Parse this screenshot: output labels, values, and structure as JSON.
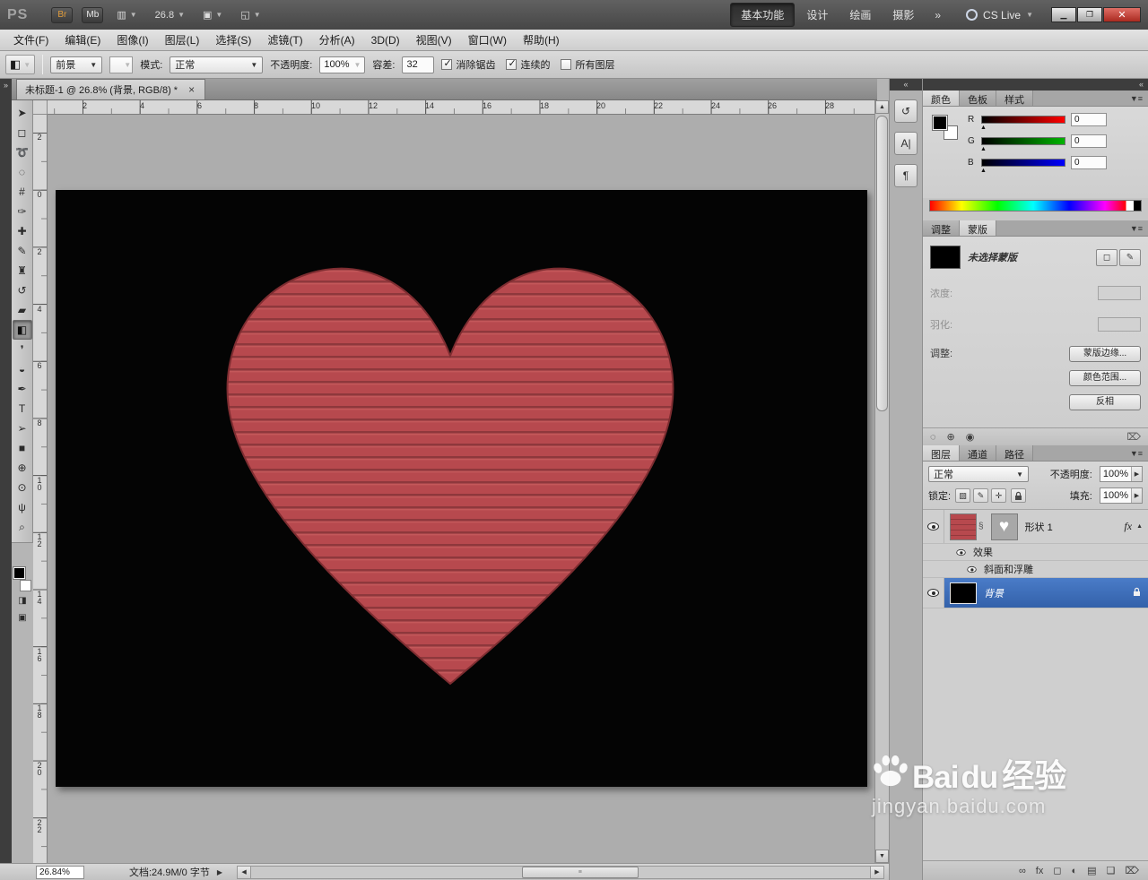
{
  "titlebar": {
    "logo": "PS",
    "bridge_button": "Br",
    "mini_bridge_button": "Mb",
    "zoom_value": "26.8",
    "workspaces": [
      {
        "name": "workspace-tab-essentials",
        "label": "基本功能",
        "active": true
      },
      {
        "name": "workspace-tab-design",
        "label": "设计"
      },
      {
        "name": "workspace-tab-painting",
        "label": "绘画"
      },
      {
        "name": "workspace-tab-photography",
        "label": "摄影"
      }
    ],
    "workspace_overflow": "»",
    "cs_live_label": "CS Live"
  },
  "menubar": {
    "items": [
      "文件(F)",
      "编辑(E)",
      "图像(I)",
      "图层(L)",
      "选择(S)",
      "滤镜(T)",
      "分析(A)",
      "3D(D)",
      "视图(V)",
      "窗口(W)",
      "帮助(H)"
    ]
  },
  "options": {
    "fill_source": "前景",
    "mode_label": "模式:",
    "mode_value": "正常",
    "opacity_label": "不透明度:",
    "opacity_value": "100%",
    "tolerance_label": "容差:",
    "tolerance_value": "32",
    "checkboxes": [
      {
        "name": "anti-alias-checkbox",
        "label": "消除锯齿",
        "checked": true
      },
      {
        "name": "contiguous-checkbox",
        "label": "连续的",
        "checked": true
      },
      {
        "name": "all-layers-checkbox",
        "label": "所有图层",
        "checked": false
      }
    ]
  },
  "document": {
    "tab_title": "未标题-1 @ 26.8% (背景, RGB/8) *",
    "close_glyph": "×"
  },
  "tools": [
    {
      "name": "move-tool",
      "glyph": "➤"
    },
    {
      "name": "rectangular-marquee-tool",
      "glyph": "◻"
    },
    {
      "name": "lasso-tool",
      "glyph": "➰"
    },
    {
      "name": "quick-selection-tool",
      "glyph": "◌"
    },
    {
      "name": "crop-tool",
      "glyph": "#"
    },
    {
      "name": "eyedropper-tool",
      "glyph": "✑"
    },
    {
      "name": "spot-healing-brush-tool",
      "glyph": "✚"
    },
    {
      "name": "brush-tool",
      "glyph": "✎"
    },
    {
      "name": "clone-stamp-tool",
      "glyph": "♜"
    },
    {
      "name": "history-brush-tool",
      "glyph": "↺"
    },
    {
      "name": "eraser-tool",
      "glyph": "▰"
    },
    {
      "name": "paint-bucket-tool",
      "glyph": "◧",
      "selected": true
    },
    {
      "name": "blur-tool",
      "glyph": "❜"
    },
    {
      "name": "dodge-tool",
      "glyph": "◒"
    },
    {
      "name": "pen-tool",
      "glyph": "✒"
    },
    {
      "name": "type-tool",
      "glyph": "T"
    },
    {
      "name": "path-selection-tool",
      "glyph": "➢"
    },
    {
      "name": "rectangle-tool",
      "glyph": "■"
    },
    {
      "name": "3d-rotate-tool",
      "glyph": "⊕"
    },
    {
      "name": "3d-orbit-tool",
      "glyph": "⊙"
    },
    {
      "name": "hand-tool",
      "glyph": "ψ"
    },
    {
      "name": "zoom-tool",
      "glyph": "⌕"
    }
  ],
  "rulers": {
    "top": [
      {
        "v": "2",
        "pos": 39
      },
      {
        "v": "4",
        "pos": 103
      },
      {
        "v": "6",
        "pos": 167
      },
      {
        "v": "8",
        "pos": 230
      },
      {
        "v": "10",
        "pos": 294
      },
      {
        "v": "12",
        "pos": 358
      },
      {
        "v": "14",
        "pos": 421
      },
      {
        "v": "16",
        "pos": 485
      },
      {
        "v": "18",
        "pos": 549
      },
      {
        "v": "20",
        "pos": 612
      },
      {
        "v": "22",
        "pos": 676
      },
      {
        "v": "24",
        "pos": 740
      },
      {
        "v": "26",
        "pos": 803
      },
      {
        "v": "28",
        "pos": 867
      }
    ],
    "left": [
      {
        "v": "2",
        "pos": 20
      },
      {
        "v": "0",
        "pos": 84
      },
      {
        "v": "2",
        "pos": 148
      },
      {
        "v": "4",
        "pos": 212
      },
      {
        "v": "6",
        "pos": 275
      },
      {
        "v": "8",
        "pos": 339
      },
      {
        "v": "10",
        "pos": 403
      },
      {
        "v": "12",
        "pos": 466
      },
      {
        "v": "14",
        "pos": 530
      },
      {
        "v": "16",
        "pos": 594
      },
      {
        "v": "18",
        "pos": 657
      },
      {
        "v": "20",
        "pos": 721
      },
      {
        "v": "22",
        "pos": 785
      }
    ]
  },
  "dock_icons": [
    {
      "name": "history-panel-icon",
      "glyph": "↺"
    },
    {
      "name": "character-panel-icon",
      "glyph": "A|"
    },
    {
      "name": "paragraph-panel-icon",
      "glyph": "¶"
    }
  ],
  "panels": {
    "color": {
      "tabs": [
        {
          "name": "tab-color",
          "label": "颜色",
          "active": true
        },
        {
          "name": "tab-swatches",
          "label": "色板"
        },
        {
          "name": "tab-styles",
          "label": "样式"
        }
      ],
      "sliders": [
        {
          "ch": "R",
          "value": "0",
          "grad": "linear-gradient(to right,#000000,#ff0000)"
        },
        {
          "ch": "G",
          "value": "0",
          "grad": "linear-gradient(to right,#000000,#00b400)"
        },
        {
          "ch": "B",
          "value": "0",
          "grad": "linear-gradient(to right,#000000,#0000ff)"
        }
      ]
    },
    "masks": {
      "tabs": [
        {
          "name": "tab-adjustments",
          "label": "调整"
        },
        {
          "name": "tab-masks",
          "label": "蒙版",
          "active": true
        }
      ],
      "title": "未选择蒙版",
      "density_label": "浓度:",
      "feather_label": "羽化:",
      "refine_label": "调整:",
      "buttons": [
        {
          "name": "mask-edge-button",
          "label": "蒙版边缘..."
        },
        {
          "name": "color-range-button",
          "label": "颜色范围..."
        },
        {
          "name": "invert-button",
          "label": "反相"
        }
      ],
      "top_icons": [
        {
          "name": "add-pixel-mask-icon",
          "glyph": "◻"
        },
        {
          "name": "add-vector-mask-icon",
          "glyph": "✎"
        }
      ],
      "foot_icons": [
        {
          "name": "mask-selection-icon",
          "glyph": "◌"
        },
        {
          "name": "apply-mask-icon",
          "glyph": "⊕"
        },
        {
          "name": "disable-mask-icon",
          "glyph": "◉"
        },
        {
          "name": "delete-mask-icon",
          "glyph": "⌦"
        }
      ]
    },
    "layers": {
      "tabs": [
        {
          "name": "tab-layers",
          "label": "图层",
          "active": true
        },
        {
          "name": "tab-channels",
          "label": "通道"
        },
        {
          "name": "tab-paths",
          "label": "路径"
        }
      ],
      "blend_mode": "正常",
      "opacity_label": "不透明度:",
      "opacity_value": "100%",
      "lock_label": "锁定:",
      "fill_label": "填充:",
      "fill_value": "100%",
      "lock_icons": [
        {
          "name": "lock-transparency-icon",
          "glyph": "▨"
        },
        {
          "name": "lock-pixels-icon",
          "glyph": "✎"
        },
        {
          "name": "lock-position-icon",
          "glyph": "✛"
        }
      ],
      "shape_layer_name": "形状 1",
      "fx_label": "fx",
      "effects_label": "效果",
      "bevel_label": "斜面和浮雕",
      "background_layer_name": "背景",
      "foot_icons": [
        {
          "name": "link-layers-icon",
          "glyph": "∞"
        },
        {
          "name": "layer-style-icon",
          "glyph": "fx"
        },
        {
          "name": "add-layer-mask-icon",
          "glyph": "◻"
        },
        {
          "name": "new-adjustment-layer-icon",
          "glyph": "◐"
        },
        {
          "name": "new-group-icon",
          "glyph": "▤"
        },
        {
          "name": "new-layer-icon",
          "glyph": "❏"
        },
        {
          "name": "delete-layer-icon",
          "glyph": "⌦"
        }
      ]
    }
  },
  "statusbar": {
    "zoom": "26.84%",
    "doc_info": "文档:24.9M/0 字节"
  },
  "watermark": {
    "brand_a": "Bai",
    "brand_b": "du",
    "brand_cn": "经验",
    "url": "jingyan.baidu.com"
  },
  "colors": {
    "heart_base": "#b7494e",
    "heart_stripe_dark": "#8e383c",
    "heart_stripe_light": "#c4585a",
    "canvas_black": "#050505",
    "selected_layer_blue": "#3a68b2",
    "workspace_gray": "#adadad"
  }
}
